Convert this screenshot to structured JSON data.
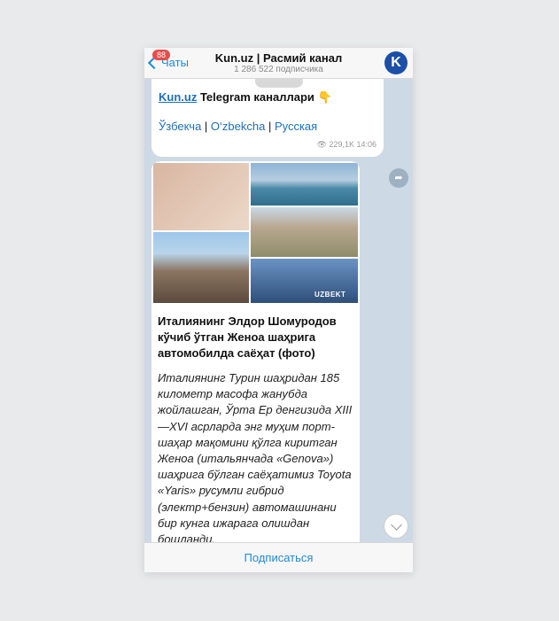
{
  "header": {
    "back_label": "Чаты",
    "badge": "88",
    "title": "Kun.uz | Расмий канал",
    "subtitle": "1 286 522 подписчика",
    "avatar_letter": "K"
  },
  "message1": {
    "link": "Kun.uz",
    "text": " Telegram каналлари ",
    "emoji": "👇",
    "languages": [
      "Ўзбекча",
      "O‘zbekcha",
      "Русская"
    ],
    "separator": " | ",
    "views": "229,1K",
    "time": "14:06"
  },
  "message2": {
    "watermark": "UZBEKT",
    "headline": "Италиянинг Элдор Шомуродов кўчиб ўтган Женоа шаҳрига автомобилда саёҳат (фото)",
    "body": "Италиянинг Турин шаҳридан 185 километр масофа жанубда жойлашган, Ўрта Ер денгизида XIII—XVI асрларда энг муҳим порт-шаҳар мақомини қўлга киритган Женоа (итальянчада «Genova») шаҳрига бўлган саёҳатимиз Toyota «Yaris» русумли гибрид (электр+бензин) автомашинани бир кунга ижарага олишдан бошланди."
  },
  "footer": {
    "subscribe_label": "Подписаться"
  },
  "icons": {
    "back": "chevron-left-icon",
    "forward": "share-icon",
    "scroll": "chevron-down-icon",
    "views": "eye-icon"
  },
  "colors": {
    "accent": "#1f8ad6",
    "badge": "#e94b4b",
    "avatar": "#1b4fa8",
    "chat_bg": "#cdd9e5"
  }
}
